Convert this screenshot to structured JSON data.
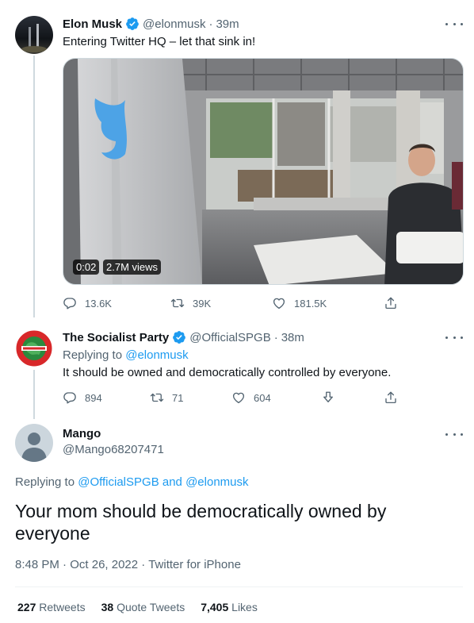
{
  "tweet1": {
    "name": "Elon Musk",
    "handle": "@elonmusk",
    "time": "39m",
    "text": "Entering Twitter HQ – let that sink in!",
    "video_time": "0:02",
    "video_views": "2.7M views",
    "replies": "13.6K",
    "retweets": "39K",
    "likes": "181.5K"
  },
  "tweet2": {
    "name": "The Socialist Party",
    "handle": "@OfficialSPGB",
    "time": "38m",
    "replying_prefix": "Replying to",
    "replying_handle": "@elonmusk",
    "text": "It should be owned and democratically controlled by everyone.",
    "replies": "894",
    "retweets": "71",
    "likes": "604"
  },
  "tweet3": {
    "name": "Mango",
    "handle": "@Mango68207471",
    "replying_prefix": "Replying to",
    "replying_handle1": "@OfficialSPGB",
    "replying_and": "and",
    "replying_handle2": "@elonmusk",
    "text": "Your mom should be democratically owned by everyone",
    "timestamp": "8:48 PM",
    "date": "Oct 26, 2022",
    "source": "Twitter for iPhone",
    "retweets_count": "227",
    "retweets_label": "Retweets",
    "quotes_count": "38",
    "quotes_label": "Quote Tweets",
    "likes_count": "7,405",
    "likes_label": "Likes"
  },
  "colors": {
    "accent": "#1d9bf0",
    "secondary_text": "#536471",
    "verified": "#1d9bf0"
  },
  "icons": [
    "verified-badge-icon",
    "more-icon",
    "reply-icon",
    "retweet-icon",
    "like-icon",
    "share-icon",
    "downvote-icon"
  ]
}
